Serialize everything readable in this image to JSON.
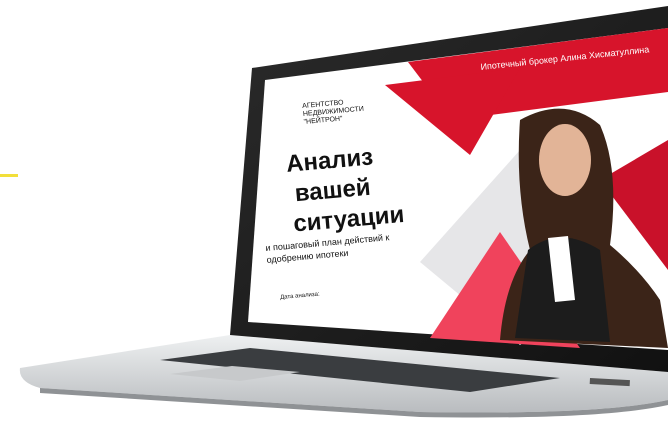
{
  "screen": {
    "agency": "АГЕНТСТВО НЕДВИЖИМОСТИ \"НЕЙТРОН\"",
    "headline": [
      "Анализ",
      "вашей",
      "ситуации"
    ],
    "subline": "и пошаговый план действий к одобрению ипотеки",
    "date_label": "Дата анализа:",
    "broker_caption": "Ипотечный брокер Алина Хисматуллина"
  },
  "colors": {
    "accent_red": "#d7142b",
    "accent_pink": "#f0435c",
    "accent_yellow": "#f2df3a",
    "laptop_silver": "#d9dbdd"
  }
}
